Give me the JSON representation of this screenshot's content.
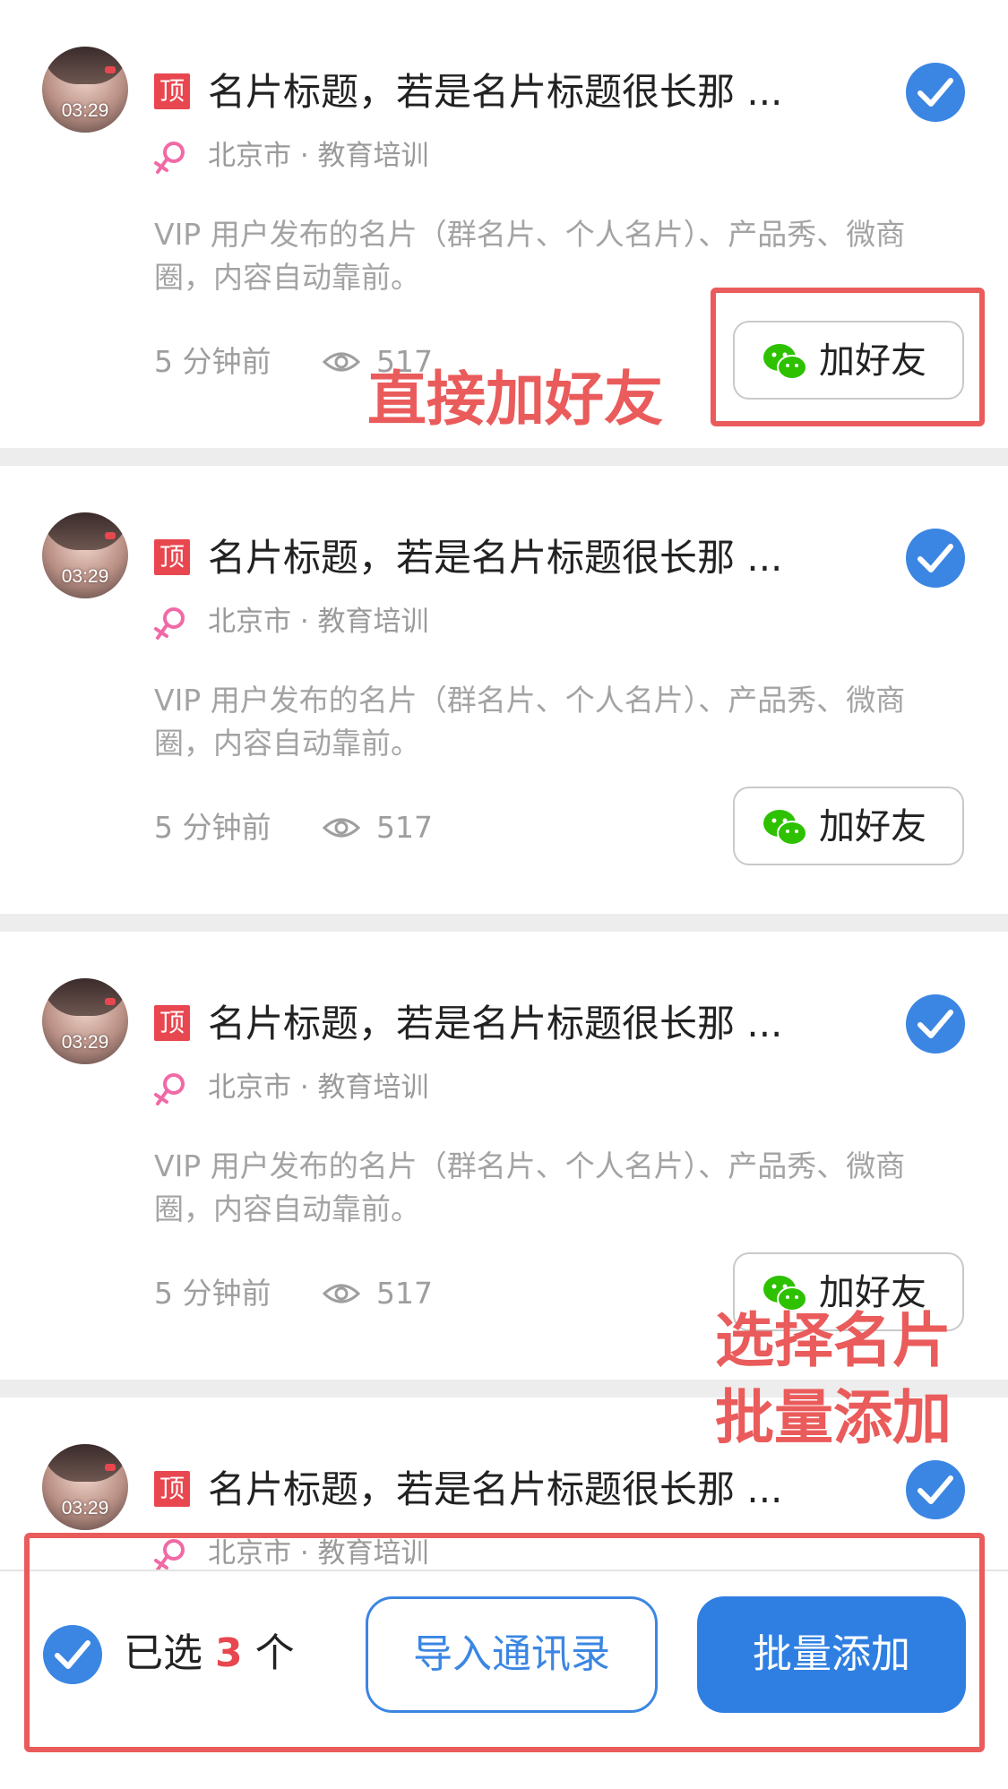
{
  "cards": [
    {
      "avatar_time": "03:29",
      "badge": "顶",
      "title": "名片标题，若是名片标题很长那 ...",
      "meta": "北京市 · 教育培训",
      "description": "VIP 用户发布的名片（群名片、个人名片）、产品秀、微商圈，内容自动靠前。",
      "time_ago": "5 分钟前",
      "views": "517",
      "add_label": "加好友",
      "selected": true
    },
    {
      "avatar_time": "03:29",
      "badge": "顶",
      "title": "名片标题，若是名片标题很长那 ...",
      "meta": "北京市 · 教育培训",
      "description": "VIP 用户发布的名片（群名片、个人名片）、产品秀、微商圈，内容自动靠前。",
      "time_ago": "5 分钟前",
      "views": "517",
      "add_label": "加好友",
      "selected": true
    },
    {
      "avatar_time": "03:29",
      "badge": "顶",
      "title": "名片标题，若是名片标题很长那 ...",
      "meta": "北京市 · 教育培训",
      "description": "VIP 用户发布的名片（群名片、个人名片）、产品秀、微商圈，内容自动靠前。",
      "time_ago": "5 分钟前",
      "views": "517",
      "add_label": "加好友",
      "selected": true
    },
    {
      "avatar_time": "03:29",
      "badge": "顶",
      "title": "名片标题，若是名片标题很长那 ...",
      "meta": "北京市 · 教育培训",
      "description": "",
      "time_ago": "",
      "views": "",
      "add_label": "",
      "selected": true
    }
  ],
  "annotations": {
    "direct_add": "直接加好友",
    "batch_line1": "选择名片",
    "batch_line2": "批量添加"
  },
  "bottom_bar": {
    "selected_prefix": "已选",
    "selected_count": "3",
    "selected_suffix": "个",
    "import_label": "导入通讯录",
    "batch_label": "批量添加"
  },
  "colors": {
    "accent": "#3b86e3",
    "badge_red": "#e8474f",
    "annotation_red": "#ea5b5b",
    "wechat_green": "#2dc100",
    "gender_pink": "#f06aa6"
  },
  "icons": {
    "check": "check-circle-icon",
    "eye": "eye-icon",
    "wechat": "wechat-icon",
    "gender": "female-icon"
  }
}
